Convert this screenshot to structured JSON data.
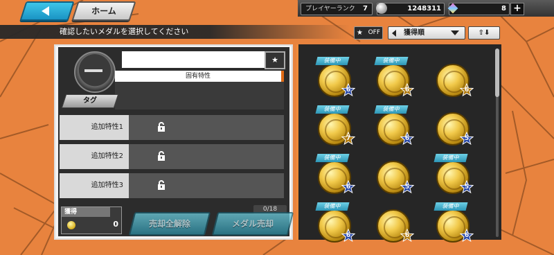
{
  "header": {
    "back_label": "",
    "home_label": "ホーム",
    "player_rank_label": "プレイヤーランク",
    "player_rank_value": "7",
    "coins": "1248311",
    "gems": "8"
  },
  "toolbar": {
    "instruction": "確認したいメダルを選択してください",
    "filter_toggle": "OFF",
    "sort_label": "獲得順"
  },
  "detail": {
    "unique_trait_label": "固有特性",
    "tag_label": "タグ",
    "traits": [
      {
        "label": "追加特性1"
      },
      {
        "label": "追加特性2"
      },
      {
        "label": "追加特性3"
      }
    ],
    "obtain_label": "獲得",
    "obtain_value": "0",
    "sell_cancel_label": "売却全解除",
    "sell_label": "メダル売却",
    "sell_count": "0/18"
  },
  "medals": [
    {
      "equipped": "装備中",
      "stars": "6",
      "star_color": "blue"
    },
    {
      "equipped": "装備中",
      "stars": "6",
      "star_color": "gold"
    },
    {
      "equipped": "",
      "stars": "6",
      "star_color": "gold"
    },
    {
      "equipped": "装備中",
      "stars": "7",
      "star_color": "gold"
    },
    {
      "equipped": "装備中",
      "stars": "6",
      "star_color": "blue"
    },
    {
      "equipped": "",
      "stars": "5",
      "star_color": "blue"
    },
    {
      "equipped": "装備中",
      "stars": "6",
      "star_color": "blue"
    },
    {
      "equipped": "",
      "stars": "5",
      "star_color": "blue"
    },
    {
      "equipped": "装備中",
      "stars": "5",
      "star_color": "blue"
    },
    {
      "equipped": "装備中",
      "stars": "6",
      "star_color": "blue"
    },
    {
      "equipped": "",
      "stars": "6",
      "star_color": "gold"
    },
    {
      "equipped": "装備中",
      "stars": "6",
      "star_color": "blue"
    }
  ],
  "colors": {
    "accent": "#e8833e",
    "panel_dark": "#262626",
    "button_blue": "#3ec5e8"
  }
}
